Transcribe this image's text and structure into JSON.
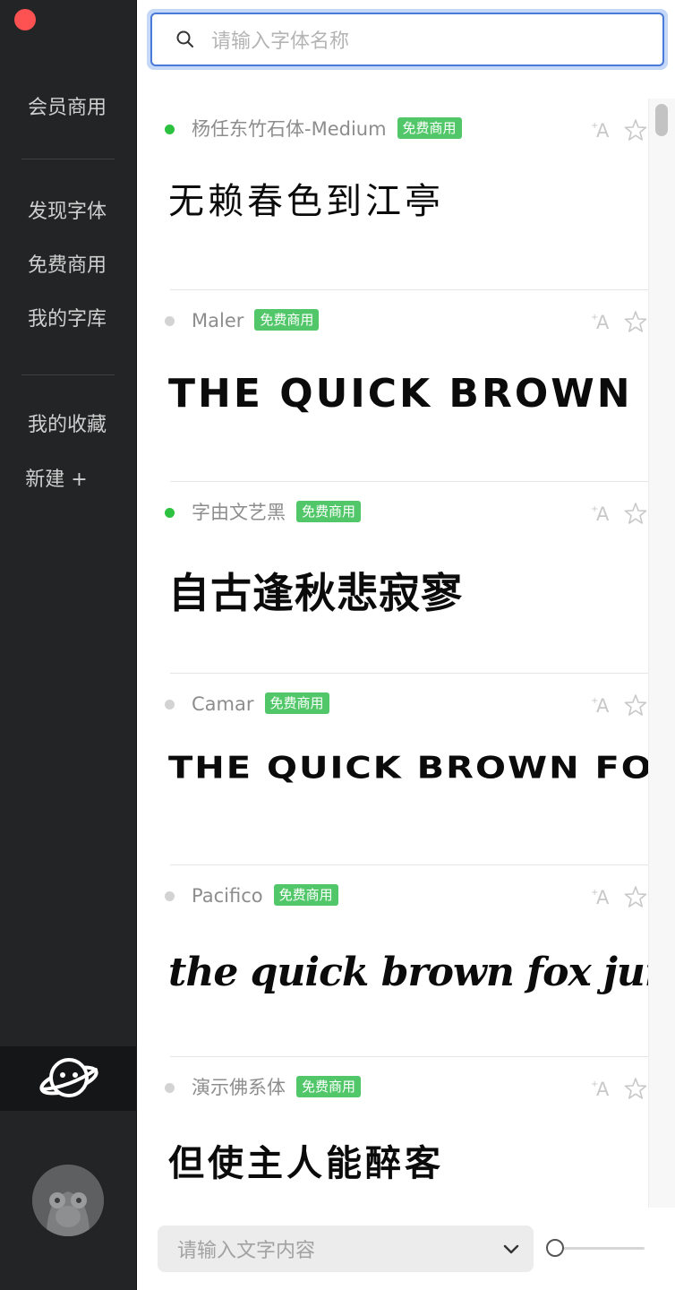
{
  "sidebar": {
    "items": [
      {
        "label": "会员商用"
      },
      {
        "label": "发现字体"
      },
      {
        "label": "免费商用"
      },
      {
        "label": "我的字库"
      },
      {
        "label": "我的收藏"
      },
      {
        "label": "新建 +"
      }
    ],
    "planet_icon": "planet-icon",
    "avatar_icon": "monkey-avatar"
  },
  "search": {
    "placeholder": "请输入字体名称"
  },
  "fonts": [
    {
      "name": "杨任东竹石体-Medium",
      "badge": "免费商用",
      "status": "active",
      "status_color": "#2cc13f",
      "preview": "无赖春色到江亭"
    },
    {
      "name": "Maler",
      "badge": "免费商用",
      "status": "inactive",
      "status_color": "#d3d3d3",
      "preview": "THE QUICK BROWN FOX"
    },
    {
      "name": "字由文艺黑",
      "badge": "免费商用",
      "status": "active",
      "status_color": "#2cc13f",
      "preview": "自古逢秋悲寂寥"
    },
    {
      "name": "Camar",
      "badge": "免费商用",
      "status": "inactive",
      "status_color": "#d3d3d3",
      "preview": "THE QUICK BROWN FOX"
    },
    {
      "name": "Pacifico",
      "badge": "免费商用",
      "status": "inactive",
      "status_color": "#d3d3d3",
      "preview": "the quick brown fox jumps over"
    },
    {
      "name": "演示佛系体",
      "badge": "免费商用",
      "status": "inactive",
      "status_color": "#d3d3d3",
      "preview": "但使主人能醉客"
    }
  ],
  "bottom": {
    "text_placeholder": "请输入文字内容",
    "size_slider_value": 0
  },
  "colors": {
    "badge": "#52c76a",
    "close": "#fe5152",
    "focus": "#4a7ad9"
  }
}
